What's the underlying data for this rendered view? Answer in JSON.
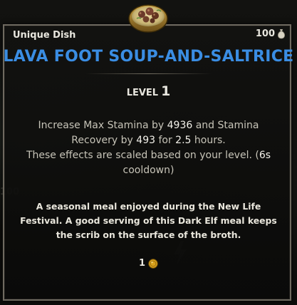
{
  "tooltip": {
    "item_type": "Unique Dish",
    "value": "100",
    "name": "LAVA FOOT SOUP-AND-SALTRICE",
    "level_label": "LEVEL",
    "level_value": "1",
    "effect": {
      "part1": "Increase Max Stamina by ",
      "stamina_amount": "4936",
      "part2": " and Stamina Recovery by ",
      "recovery_amount": "493",
      "part3": " for ",
      "duration": "2.5",
      "part4": " hours.",
      "line2_text": "These effects are scaled based on your level. (",
      "cooldown": "6s",
      "line2_end": " cooldown)"
    },
    "flavor_text": "A seasonal meal enjoyed during the New Life Festival. A good serving of this Dark Elf meal keeps the scrib on the surface of the broth.",
    "cost_amount": "1"
  },
  "background": {
    "ghost_value": "100"
  },
  "icons": {
    "item": "soup-bowl-icon",
    "value": "money-bag-icon",
    "cost": "gold-coin-icon"
  },
  "colors": {
    "title": "#3a8de3",
    "border": "#6f6a60",
    "text": "#e9e7df",
    "body_text": "#c7c4b8",
    "coin": "#d9a21c"
  }
}
